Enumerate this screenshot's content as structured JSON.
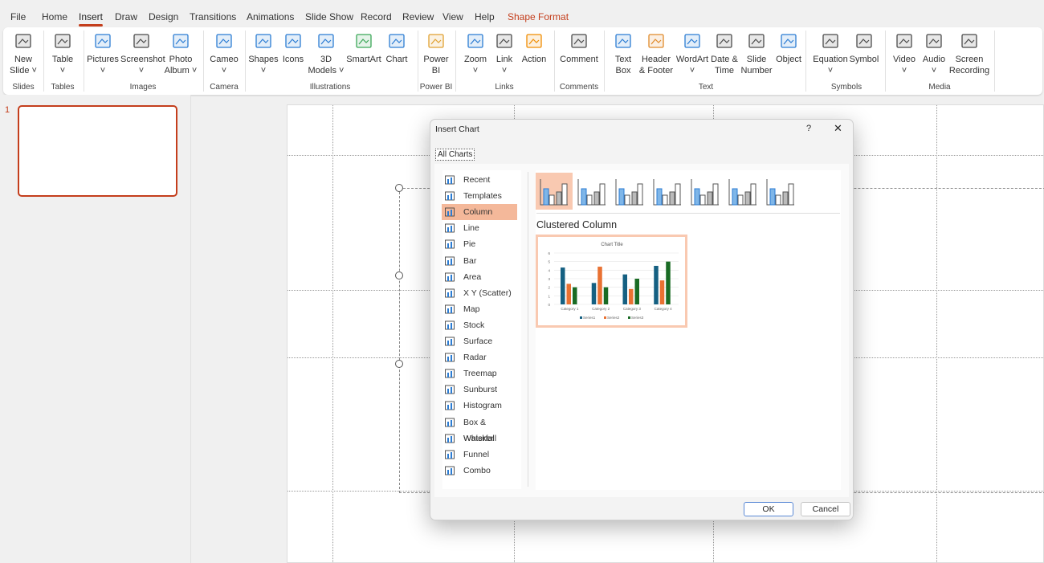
{
  "menu_tabs": [
    {
      "label": "File"
    },
    {
      "label": "Home"
    },
    {
      "label": "Insert",
      "active": true
    },
    {
      "label": "Draw"
    },
    {
      "label": "Design"
    },
    {
      "label": "Transitions"
    },
    {
      "label": "Animations"
    },
    {
      "label": "Slide Show"
    },
    {
      "label": "Record"
    },
    {
      "label": "Review"
    },
    {
      "label": "View"
    },
    {
      "label": "Help"
    },
    {
      "label": "Shape Format",
      "contextual": true
    }
  ],
  "ribbon": {
    "buttons": [
      {
        "l1": "New",
        "l2": "Slide ˅",
        "icon": "new-slide-icon"
      },
      {
        "l1": "Table",
        "l2": "˅",
        "icon": "table-icon"
      },
      {
        "l1": "Pictures",
        "l2": "˅",
        "icon": "pictures-icon"
      },
      {
        "l1": "Screenshot",
        "l2": "˅",
        "icon": "screenshot-icon"
      },
      {
        "l1": "Photo",
        "l2": "Album ˅",
        "icon": "photo-album-icon"
      },
      {
        "l1": "Cameo",
        "l2": "˅",
        "icon": "cameo-icon"
      },
      {
        "l1": "Shapes",
        "l2": "˅",
        "icon": "shapes-icon"
      },
      {
        "l1": "Icons",
        "l2": "",
        "icon": "icons-icon"
      },
      {
        "l1": "3D",
        "l2": "Models ˅",
        "icon": "3d-models-icon"
      },
      {
        "l1": "SmartArt",
        "l2": "",
        "icon": "smartart-icon"
      },
      {
        "l1": "Chart",
        "l2": "",
        "icon": "chart-icon"
      },
      {
        "l1": "Power",
        "l2": "BI",
        "icon": "power-bi-icon"
      },
      {
        "l1": "Zoom",
        "l2": "˅",
        "icon": "zoom-icon"
      },
      {
        "l1": "Link",
        "l2": "˅",
        "icon": "link-icon"
      },
      {
        "l1": "Action",
        "l2": "",
        "icon": "action-icon"
      },
      {
        "l1": "Comment",
        "l2": "",
        "icon": "comment-icon"
      },
      {
        "l1": "Text",
        "l2": "Box",
        "icon": "text-box-icon"
      },
      {
        "l1": "Header",
        "l2": "& Footer",
        "icon": "header-footer-icon"
      },
      {
        "l1": "WordArt",
        "l2": "˅",
        "icon": "wordart-icon"
      },
      {
        "l1": "Date &",
        "l2": "Time",
        "icon": "date-time-icon"
      },
      {
        "l1": "Slide",
        "l2": "Number",
        "icon": "slide-number-icon"
      },
      {
        "l1": "Object",
        "l2": "",
        "icon": "object-icon"
      },
      {
        "l1": "Equation",
        "l2": "˅",
        "icon": "equation-icon"
      },
      {
        "l1": "Symbol",
        "l2": "",
        "icon": "symbol-icon"
      },
      {
        "l1": "Video",
        "l2": "˅",
        "icon": "video-icon"
      },
      {
        "l1": "Audio",
        "l2": "˅",
        "icon": "audio-icon"
      },
      {
        "l1": "Screen",
        "l2": "Recording",
        "icon": "screen-recording-icon"
      }
    ],
    "groups": [
      {
        "label": "Slides"
      },
      {
        "label": "Tables"
      },
      {
        "label": "Images"
      },
      {
        "label": "Camera"
      },
      {
        "label": "Illustrations"
      },
      {
        "label": "Power BI"
      },
      {
        "label": "Links"
      },
      {
        "label": "Comments"
      },
      {
        "label": "Text"
      },
      {
        "label": "Symbols"
      },
      {
        "label": "Media"
      }
    ]
  },
  "thumbnails": {
    "slide_number": "1"
  },
  "dialog": {
    "title": "Insert Chart",
    "help": "?",
    "close": "✕",
    "tab": "All Charts",
    "chart_types": [
      {
        "label": "Recent"
      },
      {
        "label": "Templates"
      },
      {
        "label": "Column",
        "selected": true
      },
      {
        "label": "Line"
      },
      {
        "label": "Pie"
      },
      {
        "label": "Bar"
      },
      {
        "label": "Area"
      },
      {
        "label": "X Y (Scatter)"
      },
      {
        "label": "Map"
      },
      {
        "label": "Stock"
      },
      {
        "label": "Surface"
      },
      {
        "label": "Radar"
      },
      {
        "label": "Treemap"
      },
      {
        "label": "Sunburst"
      },
      {
        "label": "Histogram"
      },
      {
        "label": "Box & Whisker"
      },
      {
        "label": "Waterfall"
      },
      {
        "label": "Funnel"
      },
      {
        "label": "Combo"
      }
    ],
    "subtypes": [
      "clustered-column",
      "stacked-column",
      "100-stacked-column",
      "3d-clustered-column",
      "3d-stacked-column",
      "3d-100-stacked-column",
      "3d-column"
    ],
    "selected_subtype": "Clustered Column",
    "ok": "OK",
    "cancel": "Cancel"
  },
  "colors": {
    "accent": "#c43e1c",
    "selection": "#f4b89a",
    "series1": "#156082",
    "series2": "#e97132",
    "series3": "#196b24"
  },
  "chart_data": {
    "type": "bar",
    "title": "Chart Title",
    "categories": [
      "Category 1",
      "Category 2",
      "Category 3",
      "Category 4"
    ],
    "series": [
      {
        "name": "Series1",
        "values": [
          4.3,
          2.5,
          3.5,
          4.5
        ]
      },
      {
        "name": "Series2",
        "values": [
          2.4,
          4.4,
          1.8,
          2.8
        ]
      },
      {
        "name": "Series3",
        "values": [
          2,
          2,
          3,
          5
        ]
      }
    ],
    "ylim": [
      0,
      6
    ],
    "yticks": [
      "0",
      "1",
      "2",
      "3",
      "4",
      "5",
      "6"
    ],
    "grid": true,
    "legend": "bottom"
  }
}
